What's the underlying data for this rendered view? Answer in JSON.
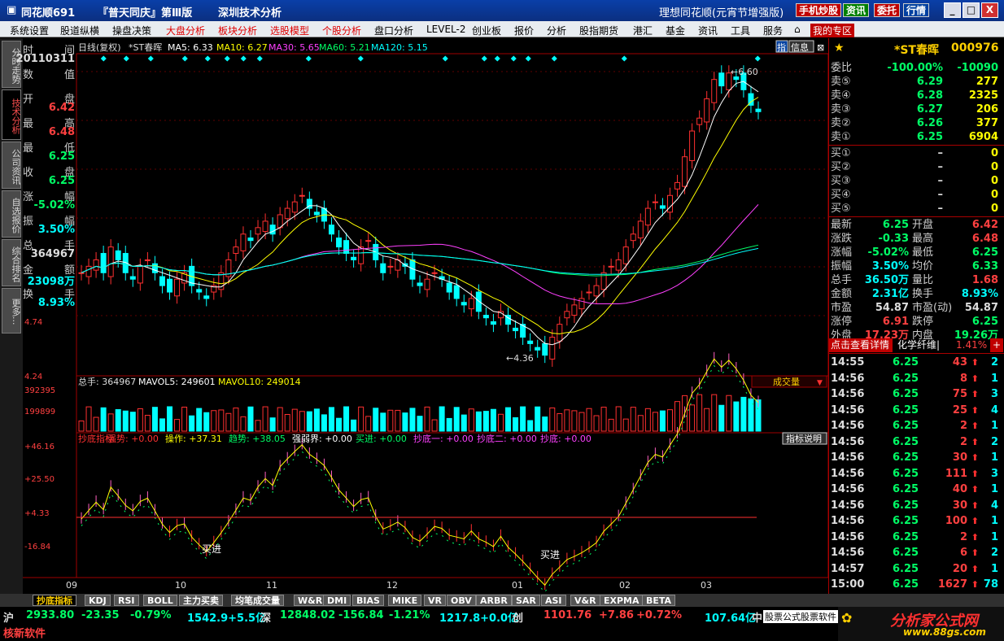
{
  "titlebar": {
    "app": "同花顺691",
    "book": "『普天同庆』第Ⅲ版",
    "module": "深圳技术分析",
    "product": "理想同花顺(元宵节增强版)",
    "btn_phone": "手机炒股",
    "btn_news": "资讯",
    "btn_trust": "委托",
    "btn_quote": "行情",
    "win_min": "_",
    "win_max": "□",
    "win_close": "X"
  },
  "menu": [
    "系统设置",
    "股道纵横",
    "操盘决策",
    "大盘分析",
    "板块分析",
    "选股模型",
    "个股分析",
    "盘口分析",
    "LEVEL-2",
    "创业板",
    "报价",
    "分析",
    "股指期货",
    "港汇",
    "基金",
    "资讯",
    "工具",
    "服务",
    "我的专区"
  ],
  "leftnav": [
    "分时走势",
    "技术分析",
    "公司资讯",
    "自选报价",
    "综合排名",
    "更多..."
  ],
  "info": {
    "rows": [
      {
        "label_l": "时",
        "label_r": "间",
        "value": "20110311",
        "color": "#dddddd"
      },
      {
        "label_l": "数",
        "label_r": "值",
        "value": "",
        "color": "#dddddd"
      },
      {
        "label_l": "开",
        "label_r": "盘",
        "value": "6.42",
        "color": "#ff4040"
      },
      {
        "label_l": "最",
        "label_r": "高",
        "value": "6.48",
        "color": "#ff4040"
      },
      {
        "label_l": "最",
        "label_r": "低",
        "value": "6.25",
        "color": "#00ff66"
      },
      {
        "label_l": "收",
        "label_r": "盘",
        "value": "6.25",
        "color": "#00ff66"
      },
      {
        "label_l": "涨",
        "label_r": "幅",
        "value": "-5.02%",
        "color": "#00ff66"
      },
      {
        "label_l": "振",
        "label_r": "幅",
        "value": "3.50%",
        "color": "#00ffff"
      },
      {
        "label_l": "总",
        "label_r": "手",
        "value": "364967",
        "color": "#dddddd"
      },
      {
        "label_l": "金",
        "label_r": "额",
        "value": "23098万",
        "color": "#00ffff"
      },
      {
        "label_l": "换",
        "label_r": "手",
        "value": "8.93%",
        "color": "#00ffff"
      }
    ]
  },
  "chart_header": {
    "period": "日线(复权)",
    "name": "*ST春晖",
    "ma5": "MA5: 6.33",
    "ma10": "MA10: 6.27",
    "ma30": "MA30: 5.65",
    "ma60": "MA60: 5.21",
    "ma120": "MA120: 5.15",
    "btn_index": "指",
    "btn_info": "信息"
  },
  "price_axis": [
    "4.74",
    "4.24"
  ],
  "annotations": {
    "high": "6.60",
    "low": "4.36"
  },
  "volume": {
    "header_total": "总手: 364967",
    "header_mavol5": "MAVOL5: 249601",
    "header_mavol10": "MAVOL10: 249014",
    "axis": [
      "392395",
      "199899"
    ],
    "dropdown": "成交量"
  },
  "indicator": {
    "title": "抄底指标",
    "header": [
      {
        "t": "抄底指标",
        "c": "#ff3030"
      },
      {
        "t": "强势: +0.00",
        "c": "#ff3030"
      },
      {
        "t": "操作: +37.31",
        "c": "#ffff00"
      },
      {
        "t": "趋势: +38.05",
        "c": "#00ff66"
      },
      {
        "t": "强弱界: +0.00",
        "c": "#ffffff"
      },
      {
        "t": "买进: +0.00",
        "c": "#00ff66"
      },
      {
        "t": "抄底一: +0.00",
        "c": "#ff40ff"
      },
      {
        "t": "抄底二: +0.00",
        "c": "#ff40ff"
      },
      {
        "t": "抄底: +0.00",
        "c": "#ff40ff"
      }
    ],
    "btn_explain": "指标说明",
    "axis": [
      "+46.16",
      "+25.50",
      "+4.33",
      "-16.84"
    ],
    "buy_label": "买进"
  },
  "xaxis": [
    "09",
    "10",
    "11",
    "12",
    "01",
    "02",
    "03"
  ],
  "bottom_tabs": [
    "抄底指标",
    "KDJ",
    "RSI",
    "BOLL",
    "主力买卖",
    "均笔成交量",
    "W&R",
    "DMI",
    "BIAS",
    "MIKE",
    "VR",
    "OBV",
    "ARBR",
    "SAR",
    "ASI",
    "V&R",
    "EXPMA",
    "BETA"
  ],
  "right_panel": {
    "title": "*ST春晖",
    "code": "000976",
    "weibi_label": "委比",
    "weibi_pct": "-100.00%",
    "weibi_val": "-10090",
    "asks": [
      {
        "label": "卖⑤",
        "price": "6.29",
        "vol": "277"
      },
      {
        "label": "卖④",
        "price": "6.28",
        "vol": "2325"
      },
      {
        "label": "卖③",
        "price": "6.27",
        "vol": "206"
      },
      {
        "label": "卖②",
        "price": "6.26",
        "vol": "377"
      },
      {
        "label": "卖①",
        "price": "6.25",
        "vol": "6904"
      }
    ],
    "bids": [
      {
        "label": "买①",
        "price": "–",
        "vol": "0"
      },
      {
        "label": "买②",
        "price": "–",
        "vol": "0"
      },
      {
        "label": "买③",
        "price": "–",
        "vol": "0"
      },
      {
        "label": "买④",
        "price": "–",
        "vol": "0"
      },
      {
        "label": "买⑤",
        "price": "–",
        "vol": "0"
      }
    ],
    "stats": [
      {
        "l1": "最新",
        "v1": "6.25",
        "c1": "#00ff66",
        "l2": "开盘",
        "v2": "6.42",
        "c2": "#ff4040"
      },
      {
        "l1": "涨跌",
        "v1": "-0.33",
        "c1": "#00ff66",
        "l2": "最高",
        "v2": "6.48",
        "c2": "#ff4040"
      },
      {
        "l1": "涨幅",
        "v1": "-5.02%",
        "c1": "#00ff66",
        "l2": "最低",
        "v2": "6.25",
        "c2": "#00ff66"
      },
      {
        "l1": "振幅",
        "v1": "3.50%",
        "c1": "#00ffff",
        "l2": "均价",
        "v2": "6.33",
        "c2": "#00ff66"
      },
      {
        "l1": "总手",
        "v1": "36.50万",
        "c1": "#00ffff",
        "l2": "量比",
        "v2": "1.68",
        "c2": "#ff4040"
      },
      {
        "l1": "金额",
        "v1": "2.31亿",
        "c1": "#00ffff",
        "l2": "换手",
        "v2": "8.93%",
        "c2": "#00ffff"
      },
      {
        "l1": "市盈",
        "v1": "54.87",
        "c1": "#dddddd",
        "l2": "市盈(动)",
        "v2": "54.87",
        "c2": "#dddddd"
      },
      {
        "l1": "涨停",
        "v1": "6.91",
        "c1": "#ff4040",
        "l2": "跌停",
        "v2": "6.25",
        "c2": "#00ff66"
      },
      {
        "l1": "外盘",
        "v1": "17.23万",
        "c1": "#ff4040",
        "l2": "内盘",
        "v2": "19.26万",
        "c2": "#00ff66"
      }
    ],
    "detail_btn": "点击查看详情",
    "sector": "化学纤维|",
    "sector_pct": "1.41%",
    "plus": "+",
    "ticks": [
      {
        "t": "14:55",
        "p": "6.25",
        "v": "43",
        "n": "2"
      },
      {
        "t": "14:56",
        "p": "6.25",
        "v": "8",
        "n": "1"
      },
      {
        "t": "14:56",
        "p": "6.25",
        "v": "75",
        "n": "3"
      },
      {
        "t": "14:56",
        "p": "6.25",
        "v": "25",
        "n": "4"
      },
      {
        "t": "14:56",
        "p": "6.25",
        "v": "2",
        "n": "1"
      },
      {
        "t": "14:56",
        "p": "6.25",
        "v": "2",
        "n": "2"
      },
      {
        "t": "14:56",
        "p": "6.25",
        "v": "30",
        "n": "1"
      },
      {
        "t": "14:56",
        "p": "6.25",
        "v": "111",
        "n": "3"
      },
      {
        "t": "14:56",
        "p": "6.25",
        "v": "40",
        "n": "1"
      },
      {
        "t": "14:56",
        "p": "6.25",
        "v": "30",
        "n": "4"
      },
      {
        "t": "14:56",
        "p": "6.25",
        "v": "100",
        "n": "1"
      },
      {
        "t": "14:56",
        "p": "6.25",
        "v": "2",
        "n": "1"
      },
      {
        "t": "14:56",
        "p": "6.25",
        "v": "6",
        "n": "2"
      },
      {
        "t": "14:57",
        "p": "6.25",
        "v": "20",
        "n": "1"
      },
      {
        "t": "15:00",
        "p": "6.25",
        "v": "1627",
        "n": "78"
      }
    ]
  },
  "statusbar": {
    "sh_label": "沪",
    "sh_idx": "2933.80",
    "sh_chg": "-23.35",
    "sh_pct": "-0.79%",
    "sh_amt": "1542.9+5.5亿",
    "sz_label": "深",
    "sz_idx": "12848.02",
    "sz_chg": "-156.84",
    "sz_pct": "-1.21%",
    "sz_amt": "1217.8+0.0亿",
    "cy_label": "创",
    "cy_idx": "1101.76",
    "cy_chg": "+7.86",
    "cy_pct": "+0.72%",
    "cy_amt": "107.64亿",
    "zhong": "中",
    "ticker": "股票公式股票软件",
    "vendor": "核新软件",
    "brand": "分析家公式网",
    "brand_url": "www.88gs.com"
  }
}
